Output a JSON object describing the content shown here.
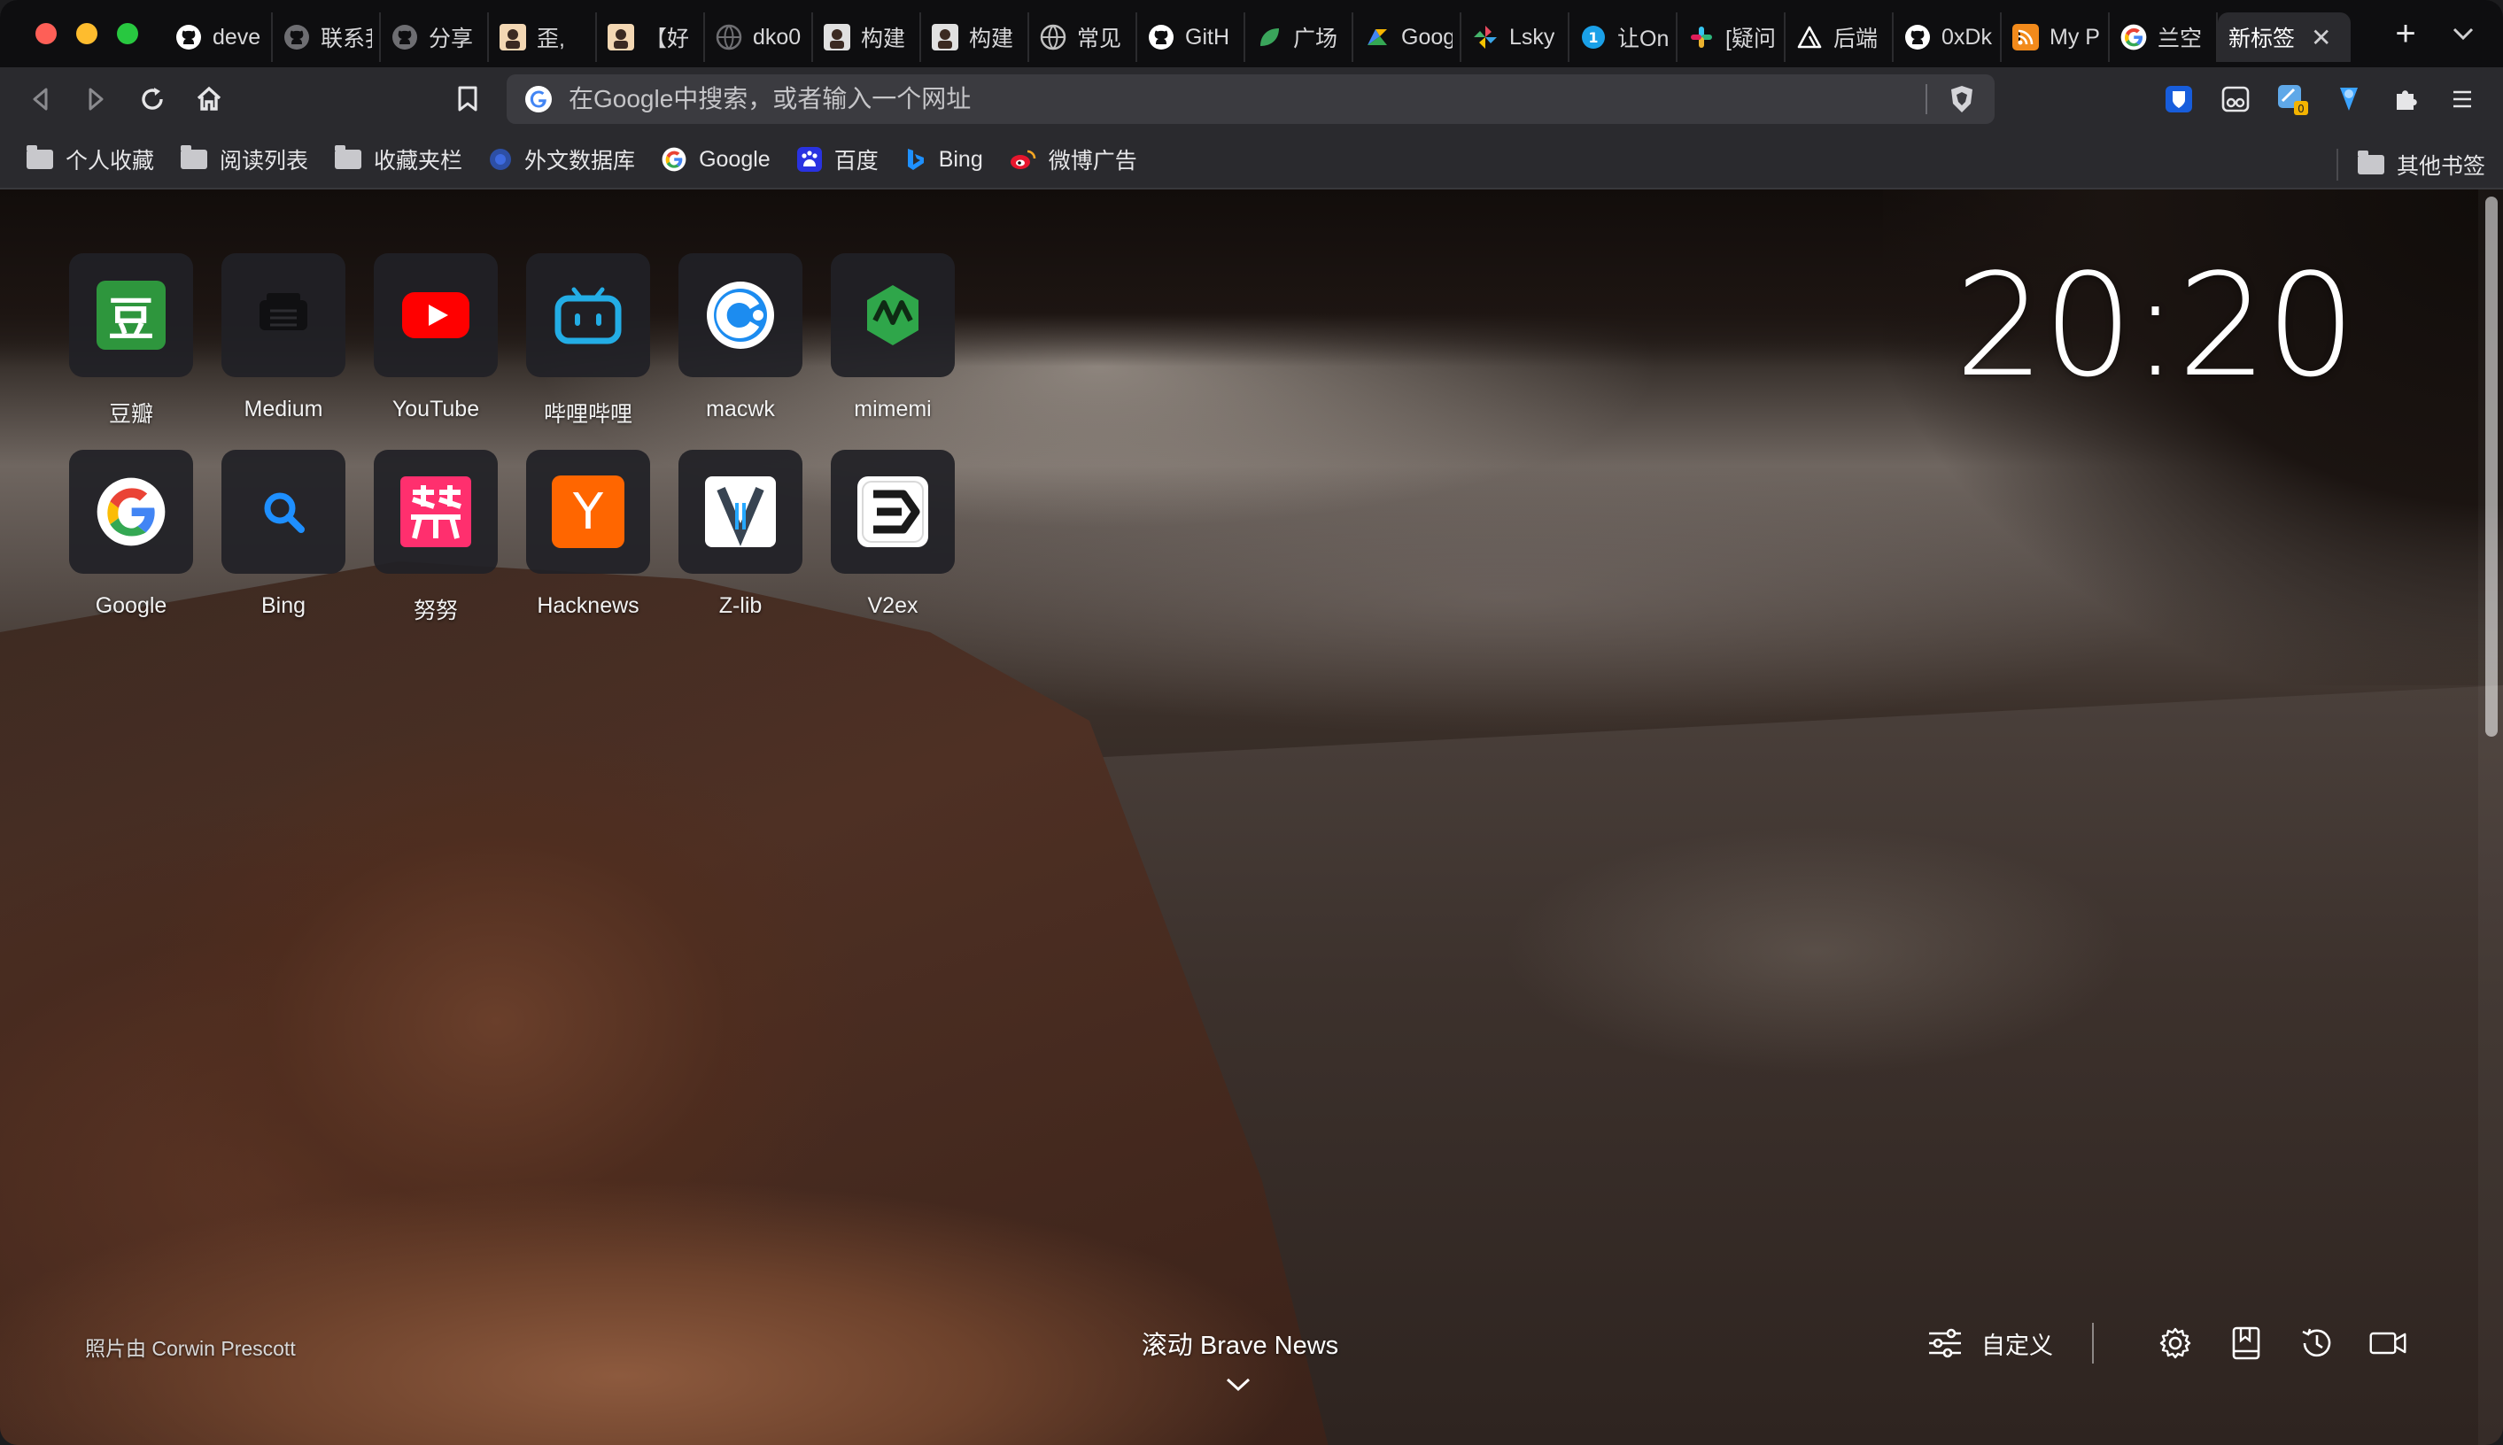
{
  "tabs": [
    {
      "label": "deve",
      "icon": "github-icon",
      "color": "#ffffff"
    },
    {
      "label": "联系我",
      "icon": "github-icon",
      "color": "#6e6e72"
    },
    {
      "label": "分享",
      "icon": "github-icon",
      "color": "#6e6e72"
    },
    {
      "label": "歪,",
      "icon": "avatar-icon",
      "color": "#f3d7b3"
    },
    {
      "label": "【好",
      "icon": "avatar-icon",
      "color": "#f3d7b3"
    },
    {
      "label": "dko0",
      "icon": "globe-icon",
      "color": "#6e6e72"
    },
    {
      "label": "构建",
      "icon": "avatar-icon",
      "color": "#e0e0e0"
    },
    {
      "label": "构建",
      "icon": "avatar-icon",
      "color": "#e0e0e0"
    },
    {
      "label": "常见",
      "icon": "globe-icon",
      "color": "#c0c0c0"
    },
    {
      "label": "GitH",
      "icon": "github-icon",
      "color": "#ffffff"
    },
    {
      "label": "广场",
      "icon": "leaf-icon",
      "color": "#3aa55b"
    },
    {
      "label": "Goog",
      "icon": "google-docs-icon",
      "color": "#f7b500"
    },
    {
      "label": "Lsky",
      "icon": "pinwheel-icon",
      "color": "#e84a5f"
    },
    {
      "label": "让On",
      "icon": "circle-icon",
      "color": "#1aa0e8"
    },
    {
      "label": "[疑问",
      "icon": "slack-icon",
      "color": "#e01e5a"
    },
    {
      "label": "后端",
      "icon": "triangle-icon",
      "color": "#ffffff"
    },
    {
      "label": "0xDk",
      "icon": "github-icon",
      "color": "#ffffff"
    },
    {
      "label": "My P",
      "icon": "rss-icon",
      "color": "#f28a1b"
    },
    {
      "label": "兰空",
      "icon": "google-icon",
      "color": "#ffffff"
    },
    {
      "label": "新标签",
      "icon": "none",
      "color": "#2a2a2e",
      "active": true
    }
  ],
  "toolbar": {
    "address_placeholder": "在Google中搜索，或者输入一个网址"
  },
  "bookmarks": [
    {
      "label": "个人收藏",
      "icon": "folder-icon"
    },
    {
      "label": "阅读列表",
      "icon": "folder-icon"
    },
    {
      "label": "收藏夹栏",
      "icon": "folder-icon"
    },
    {
      "label": "外文数据库",
      "icon": "globe-icon"
    },
    {
      "label": "Google",
      "icon": "google-icon"
    },
    {
      "label": "百度",
      "icon": "baidu-icon"
    },
    {
      "label": "Bing",
      "icon": "bing-icon"
    },
    {
      "label": "微博广告",
      "icon": "weibo-icon"
    }
  ],
  "other_bookmarks": "其他书签",
  "top_sites": [
    {
      "name": "豆瓣",
      "icon": "douban-icon"
    },
    {
      "name": "Medium",
      "icon": "medium-icon"
    },
    {
      "name": "YouTube",
      "icon": "youtube-icon"
    },
    {
      "name": "哔哩哔哩",
      "icon": "bilibili-icon"
    },
    {
      "name": "macwk",
      "icon": "macwk-icon"
    },
    {
      "name": "mimemi",
      "icon": "mimemi-icon"
    },
    {
      "name": "Google",
      "icon": "google-icon"
    },
    {
      "name": "Bing",
      "icon": "search-icon"
    },
    {
      "name": "努努",
      "icon": "nunu-icon"
    },
    {
      "name": "Hacknews",
      "icon": "hackernews-icon"
    },
    {
      "name": "Z-lib",
      "icon": "zlib-icon"
    },
    {
      "name": "V2ex",
      "icon": "v2ex-icon"
    }
  ],
  "clock": "20:20",
  "photo_credit": "照片由 Corwin Prescott",
  "news": {
    "label": "滚动 Brave News"
  },
  "customize": {
    "label": "自定义"
  },
  "colors": {
    "tab_bg": "#0e0e10",
    "toolbar_bg": "#2a2a2e",
    "omnibox_bg": "#3b3b40",
    "youtube_red": "#ff0000",
    "douban_green": "#2e963d",
    "hn_orange": "#ff6600",
    "bilibili_blue": "#23ade5"
  }
}
